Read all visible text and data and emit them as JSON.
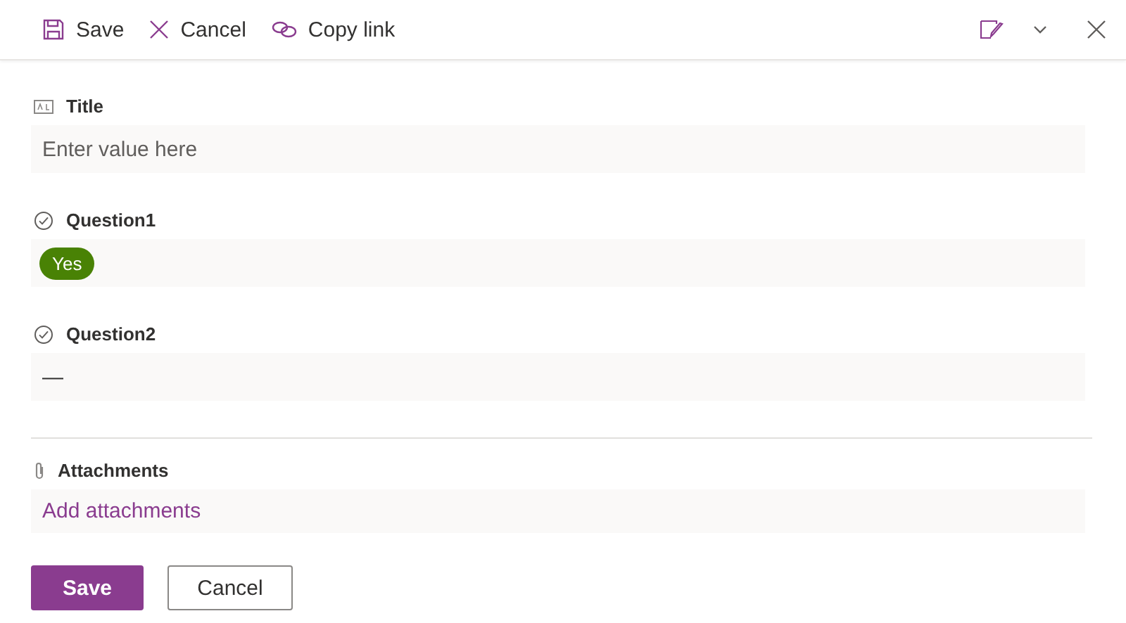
{
  "toolbar": {
    "actions": [
      {
        "kind": "save",
        "label": "Save"
      },
      {
        "kind": "cancel",
        "label": "Cancel"
      },
      {
        "kind": "link",
        "label": "Copy link"
      }
    ]
  },
  "fields": [
    {
      "kind": "text",
      "label": "Title",
      "placeholder": "Enter value here"
    },
    {
      "kind": "choice",
      "label": "Question1",
      "value": "Yes",
      "color": "#498205"
    },
    {
      "kind": "choice",
      "label": "Question2",
      "value": "—"
    }
  ],
  "attachments": {
    "label": "Attachments",
    "link": "Add attachments"
  },
  "buttons": [
    {
      "kind": "primary",
      "label": "Save"
    },
    {
      "kind": "secondary",
      "label": "Cancel"
    }
  ]
}
